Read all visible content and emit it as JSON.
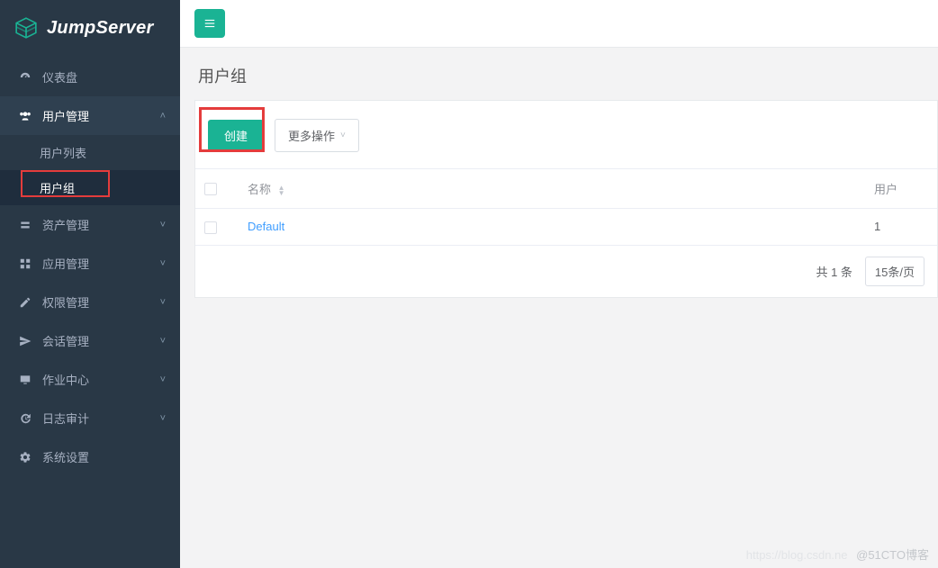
{
  "brand": {
    "name": "JumpServer"
  },
  "sidebar": {
    "items": [
      {
        "label": "仪表盘",
        "icon": "dashboard",
        "expandable": false
      },
      {
        "label": "用户管理",
        "icon": "users",
        "expanded": true,
        "children": [
          {
            "label": "用户列表"
          },
          {
            "label": "用户组",
            "active": true
          }
        ]
      },
      {
        "label": "资产管理",
        "icon": "asset"
      },
      {
        "label": "应用管理",
        "icon": "grid"
      },
      {
        "label": "权限管理",
        "icon": "edit"
      },
      {
        "label": "会话管理",
        "icon": "send"
      },
      {
        "label": "作业中心",
        "icon": "monitor"
      },
      {
        "label": "日志审计",
        "icon": "history"
      },
      {
        "label": "系统设置",
        "icon": "gear"
      }
    ]
  },
  "page": {
    "title": "用户组"
  },
  "toolbar": {
    "create_label": "创建",
    "more_label": "更多操作"
  },
  "table": {
    "columns": {
      "name": "名称",
      "user": "用户"
    },
    "rows": [
      {
        "name": "Default",
        "user": "1"
      }
    ]
  },
  "pagination": {
    "total_text": "共 1 条",
    "page_size_label": "15条/页"
  },
  "watermark": {
    "faint": "https://blog.csdn.ne",
    "text": "@51CTO博客"
  }
}
